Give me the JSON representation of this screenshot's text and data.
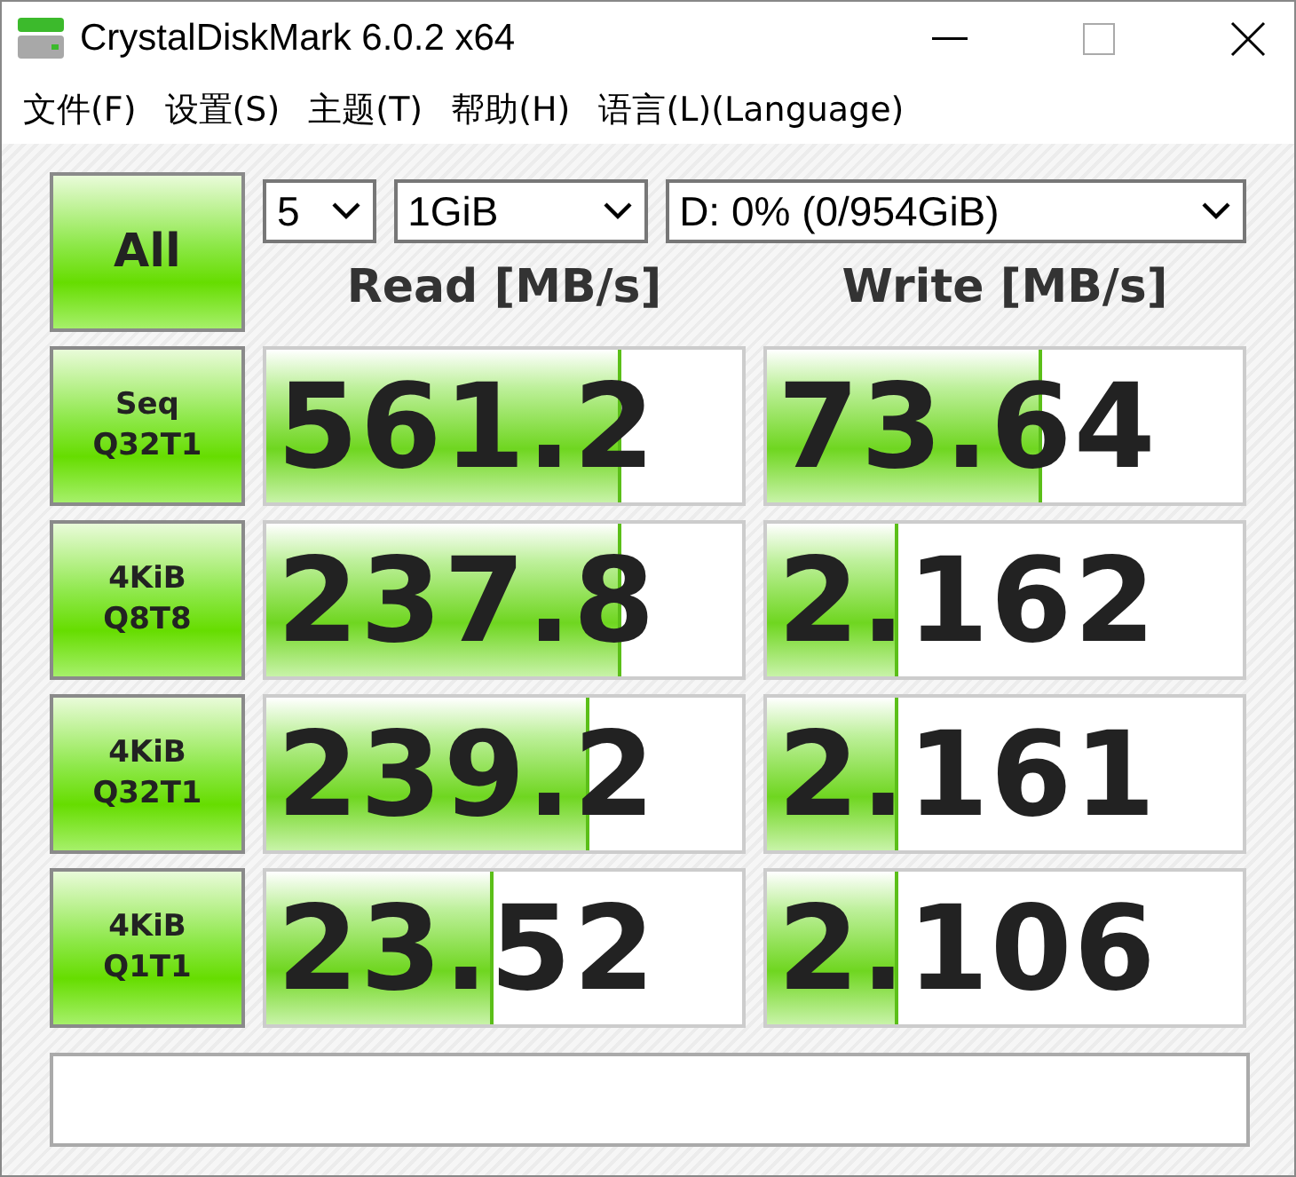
{
  "window": {
    "title": "CrystalDiskMark 6.0.2 x64"
  },
  "menu": [
    "文件(F)",
    "设置(S)",
    "主题(T)",
    "帮助(H)",
    "语言(L)(Language)"
  ],
  "all_button": "All",
  "selectors": [
    {
      "value": "5"
    },
    {
      "value": "1GiB"
    },
    {
      "value": "D: 0% (0/954GiB)"
    }
  ],
  "columns": [
    "Read [MB/s]",
    "Write [MB/s]"
  ],
  "tests": [
    {
      "label": "Seq\nQ32T1",
      "read": {
        "value": "561.2",
        "level": 0.74
      },
      "write": {
        "value": "73.64",
        "level": 0.57
      }
    },
    {
      "label": "4KiB\nQ8T8",
      "read": {
        "value": "237.8",
        "level": 0.74
      },
      "write": {
        "value": "2.162",
        "level": 0.27
      }
    },
    {
      "label": "4KiB\nQ32T1",
      "read": {
        "value": "239.2",
        "level": 0.67
      },
      "write": {
        "value": "2.161",
        "level": 0.27
      }
    },
    {
      "label": "4KiB\nQ1T1",
      "read": {
        "value": "23.52",
        "level": 0.47
      },
      "write": {
        "value": "2.106",
        "level": 0.27
      }
    }
  ]
}
